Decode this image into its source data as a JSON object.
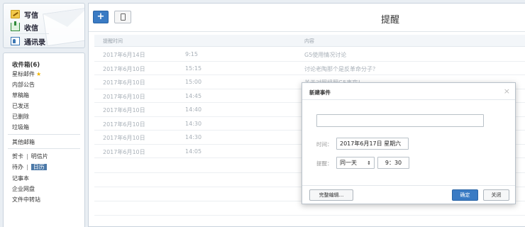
{
  "sidebar": {
    "compose": {
      "write": "写信",
      "inbox": "收信",
      "contacts": "通讯录"
    },
    "folders": {
      "inbox": "收件箱(6)",
      "starred": "星标邮件",
      "star_glyph": "★",
      "internal": "内部公告",
      "drafts": "草稿箱",
      "sent": "已发送",
      "deleted": "已删除",
      "spam": "垃圾箱",
      "other": "其他邮箱"
    },
    "tools": {
      "greeting": "贺卡",
      "postcard": "明信片",
      "todo": "待办",
      "calendar": "日历",
      "notes": "记事本",
      "netdisk": "企业网盘",
      "transfer": "文件中转站",
      "separator": "|"
    }
  },
  "toolbar": {
    "add_label": "+",
    "title": "提醒"
  },
  "table": {
    "headers": {
      "time": "提醒时间",
      "content": "内容"
    },
    "rows": [
      {
        "date": "2017年6月14日",
        "time": "9:15",
        "content": "G5使用情况讨论"
      },
      {
        "date": "2017年6月10日",
        "time": "15:15",
        "content": "讨论老陶那个是反革命分子？"
      },
      {
        "date": "2017年6月10日",
        "time": "15:00",
        "content": "关于对照组照G5事宜！"
      },
      {
        "date": "2017年6月10日",
        "time": "14:45",
        "content": ""
      },
      {
        "date": "2017年6月10日",
        "time": "14:40",
        "content": ""
      },
      {
        "date": "2017年6月10日",
        "time": "14:30",
        "content": ""
      },
      {
        "date": "2017年6月10日",
        "time": "14:30",
        "content": ""
      },
      {
        "date": "2017年6月10日",
        "time": "14:05",
        "content": ""
      }
    ]
  },
  "dialog": {
    "title": "新建事件",
    "close_glyph": "×",
    "subject_value": "",
    "time_label": "时间：",
    "date_value": "2017年6月17日 星期六",
    "remind_label": "提醒：",
    "remind_option": "同一天",
    "remind_arrow": "⇕",
    "time_value": "9：30",
    "full_edit": "完整编辑...",
    "confirm": "确定",
    "cancel": "关闭"
  },
  "colors": {
    "accent": "#3a7bc4",
    "star": "#f0b400",
    "active_nav": "#4c79a8"
  }
}
